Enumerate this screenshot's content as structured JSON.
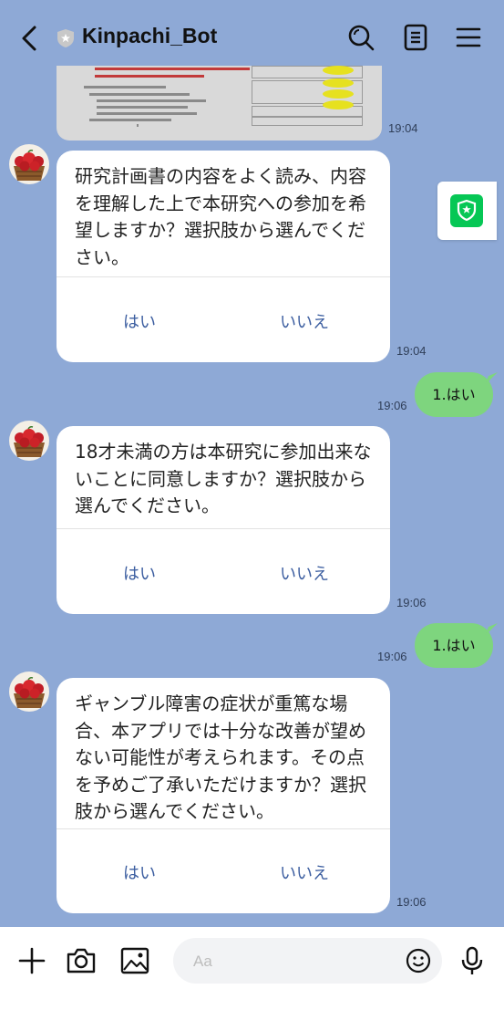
{
  "header": {
    "title": "Kinpachi_Bot"
  },
  "messages": [
    {
      "type": "image",
      "time": "19:04"
    },
    {
      "type": "bot_card",
      "text": "研究計画書の内容をよく読み、内容を理解した上で本研究への参加を希望しますか？選択肢から選んでください。",
      "options": [
        "はい",
        "いいえ"
      ],
      "time": "19:04"
    },
    {
      "type": "user",
      "text": "1.はい",
      "time": "19:06"
    },
    {
      "type": "bot_card",
      "text": "18才未満の方は本研究に参加出来ないことに同意しますか？選択肢から選んでください。",
      "options": [
        "はい",
        "いいえ"
      ],
      "time": "19:06"
    },
    {
      "type": "user",
      "text": "1.はい",
      "time": "19:06"
    },
    {
      "type": "bot_card",
      "text": "ギャンブル障害の症状が重篤な場合、本アプリでは十分な改善が望めない可能性が考えられます。その点を予めご了承いただけますか？選択肢から選んでください。",
      "options": [
        "はい",
        "いいえ"
      ],
      "time": "19:06"
    }
  ],
  "input": {
    "placeholder": "Aa"
  },
  "colors": {
    "background": "#8ea9d6",
    "user_bubble": "#7ed57e",
    "option_text": "#3c5ea0",
    "security_green": "#06c755"
  },
  "icons": [
    "back-arrow-icon",
    "shield-icon",
    "search-icon",
    "notes-icon",
    "menu-icon",
    "plus-icon",
    "camera-icon",
    "image-icon",
    "emoji-icon",
    "microphone-icon"
  ]
}
